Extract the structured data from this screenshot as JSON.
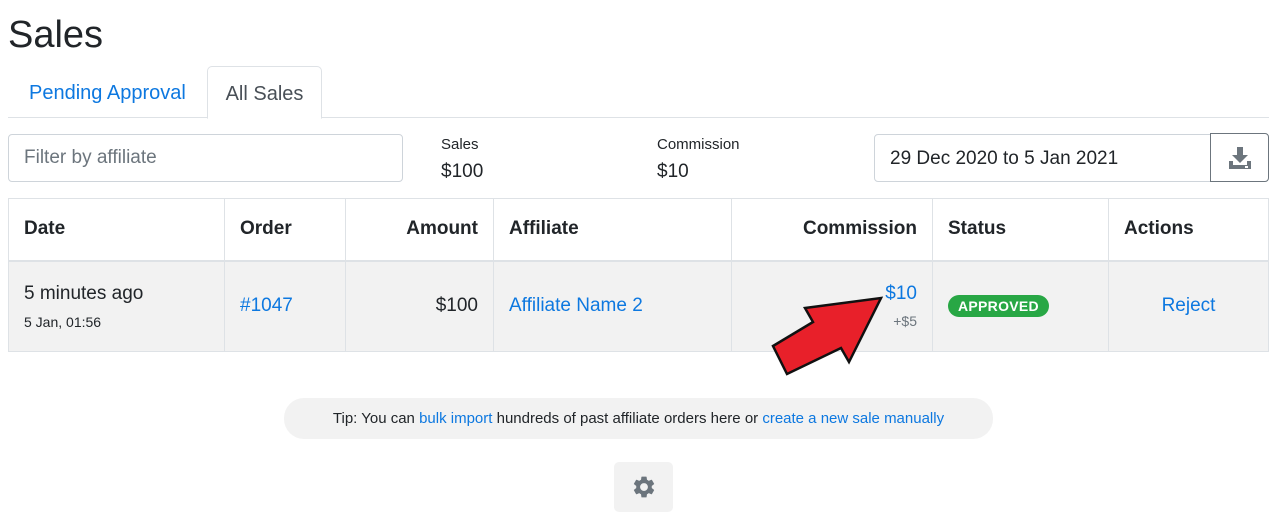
{
  "page": {
    "title": "Sales"
  },
  "tabs": [
    {
      "label": "Pending Approval",
      "active": false
    },
    {
      "label": "All Sales",
      "active": true
    }
  ],
  "filter": {
    "placeholder": "Filter by affiliate",
    "value": ""
  },
  "stats": {
    "sales_label": "Sales",
    "sales_value": "$100",
    "commission_label": "Commission",
    "commission_value": "$10"
  },
  "date_range": "29 Dec 2020 to 5 Jan 2021",
  "icons": {
    "download": "download-icon",
    "settings": "gear-icon",
    "annotation": "red-arrow"
  },
  "colors": {
    "link": "#0d78e0",
    "approved": "#28a745",
    "arrow": "#e8202a"
  },
  "table": {
    "headers": [
      "Date",
      "Order",
      "Amount",
      "Affiliate",
      "Commission",
      "Status",
      "Actions"
    ],
    "rows": [
      {
        "time_ago": "5 minutes ago",
        "time_exact": "5 Jan, 01:56",
        "order": "#1047",
        "amount": "$100",
        "affiliate": "Affiliate Name 2",
        "commission": "$10",
        "commission_sub": "+$5",
        "status": "APPROVED",
        "action": "Reject"
      }
    ]
  },
  "tip": {
    "prefix": "Tip: You can ",
    "link1": "bulk import",
    "middle": " hundreds of past affiliate orders here or ",
    "link2": "create a new sale manually"
  }
}
